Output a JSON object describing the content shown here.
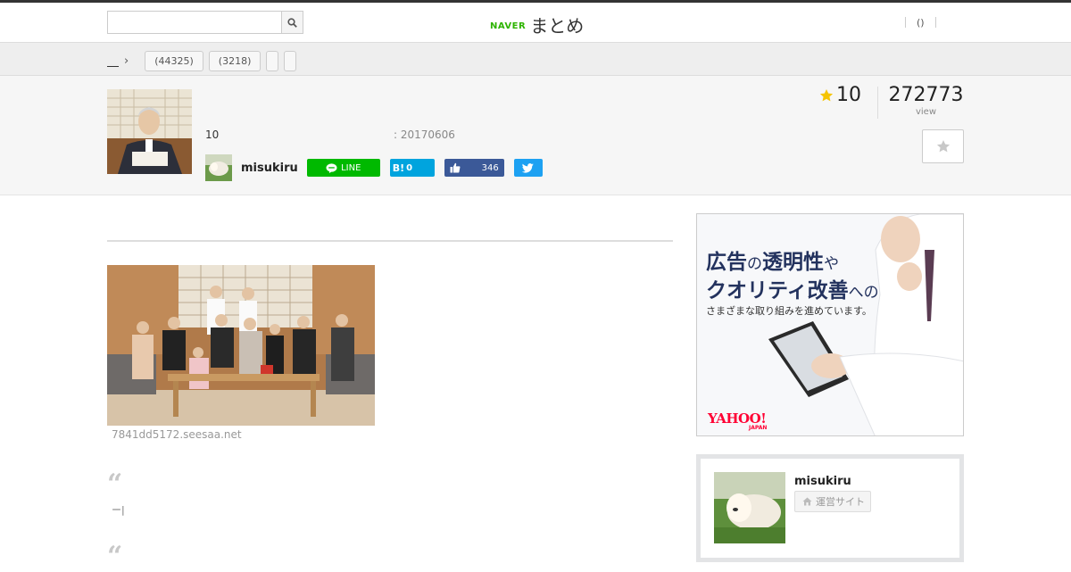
{
  "header": {
    "search_placeholder": "",
    "brand_naver": "NAVER",
    "brand_matome": "まとめ",
    "right_item": "()"
  },
  "subnav": {
    "tags": [
      "(44325)",
      "(3218)"
    ]
  },
  "summary": {
    "favorite_count": "10",
    "date": ": 20170606",
    "author": "misukiru",
    "line_label": "LINE",
    "hatena_count": "0",
    "fb_count": "346",
    "rating": "10",
    "views": "272773",
    "views_label": "view"
  },
  "content": {
    "image_source": "7841dd5172.seesaa.net",
    "quote1_text": "ー|"
  },
  "ad": {
    "line1_a": "広告",
    "line1_b": "の",
    "line1_c": "透明性",
    "line1_d": "や",
    "line2_a": "クオリティ改善",
    "line2_b": "への",
    "line3": "さまざまな取り組みを進めています。",
    "logo": "YAHOO!",
    "logo_sub": "JAPAN"
  },
  "profile": {
    "name": "misukiru",
    "site_label": "運営サイト"
  },
  "colors": {
    "line_green": "#00b900",
    "hatena_blue": "#00a4de",
    "facebook_blue": "#3b5998",
    "twitter_blue": "#1da1f2",
    "star_yellow": "#f5c400",
    "naver_green": "#2db400"
  }
}
